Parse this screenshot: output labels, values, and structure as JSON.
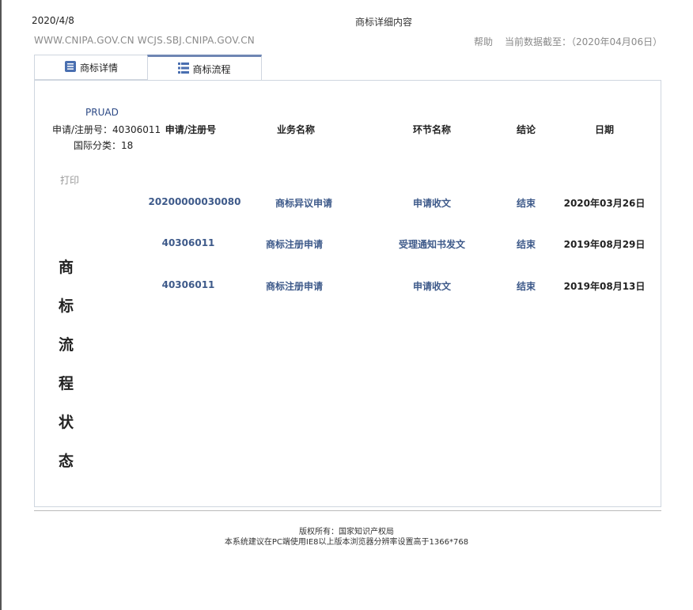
{
  "print_header": {
    "date": "2020/4/8",
    "title": "商标详细内容"
  },
  "top_bar": {
    "site_links": "WWW.CNIPA.GOV.CN  WCJS.SBJ.CNIPA.GOV.CN",
    "help": "帮助",
    "data_date": "当前数据截至：（2020年04月06日）"
  },
  "tabs": [
    {
      "label": "商标详情",
      "icon": "document-list-icon"
    },
    {
      "label": "商标流程",
      "icon": "grid-list-icon",
      "active": true
    }
  ],
  "mark_info": {
    "name": "PRUAD",
    "reg_no": "申请/注册号：40306011",
    "intl_class": "国际分类：18",
    "print": "打印"
  },
  "vertical_title": [
    "商",
    "标",
    "流",
    "程",
    "状",
    "态"
  ],
  "table": {
    "headers": [
      "申请/注册号",
      "业务名称",
      "环节名称",
      "结论",
      "日期"
    ],
    "rows": [
      {
        "reg_no": "20200000030080",
        "business": "商标异议申请",
        "stage": "申请收文",
        "result": "结束",
        "date": "2020年03月26日"
      },
      {
        "reg_no": "40306011",
        "business": "商标注册申请",
        "stage": "受理通知书发文",
        "result": "结束",
        "date": "2019年08月29日"
      },
      {
        "reg_no": "40306011",
        "business": "商标注册申请",
        "stage": "申请收文",
        "result": "结束",
        "date": "2019年08月13日"
      }
    ]
  },
  "footer": {
    "copyright": "版权所有：国家知识产权局",
    "note": "本系统建议在PC端使用IE8以上版本浏览器分辨率设置高于1366*768"
  },
  "colors": {
    "accent": "#6e86b3",
    "link_blue": "#3e5a8a",
    "border": "#cfd6df"
  }
}
